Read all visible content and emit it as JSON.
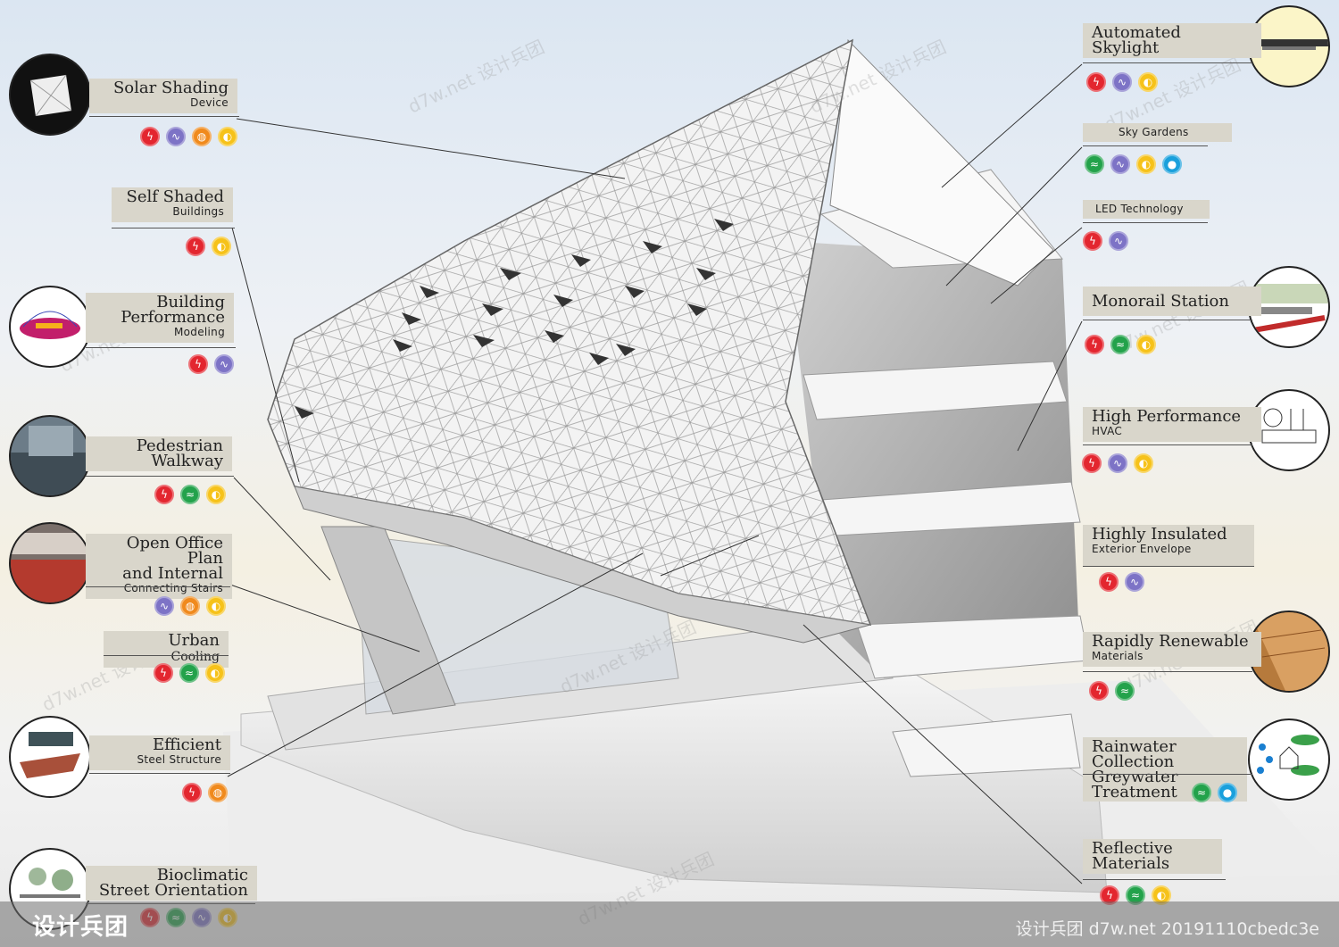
{
  "colors": {
    "energy": "#e3262f",
    "water_green": "#23a24b",
    "air": "#7d73c6",
    "materials": "#f08a1d",
    "light": "#f6c21a",
    "water": "#1aa0dc"
  },
  "icons": {
    "energy": "lightning-icon",
    "water_green": "leaf-icon",
    "air": "wind-icon",
    "materials": "material-icon",
    "light": "lightbulb-icon",
    "water": "waterdrop-icon"
  },
  "left_labels": [
    {
      "id": "solar-shading",
      "line1": "Solar Shading",
      "line2": "Device",
      "dots": [
        "energy",
        "air",
        "materials",
        "light"
      ]
    },
    {
      "id": "self-shaded",
      "line1": "Self Shaded",
      "line2": "Buildings",
      "dots": [
        "energy",
        "light"
      ]
    },
    {
      "id": "building-performance",
      "line1": "Building",
      "line1b": "Performance",
      "line2": "Modeling",
      "dots": [
        "energy",
        "air"
      ]
    },
    {
      "id": "pedestrian-walkway",
      "line1": "Pedestrian",
      "line1b": "Walkway",
      "line2": "",
      "dots": [
        "energy",
        "water_green",
        "light"
      ]
    },
    {
      "id": "open-office",
      "line1": "Open Office Plan",
      "line1b": "and Internal",
      "line2": "Connecting Stairs",
      "dots": [
        "air",
        "materials",
        "light"
      ]
    },
    {
      "id": "urban-cooling",
      "line1": "Urban",
      "line1s": "Cooling",
      "line2": "",
      "dots": [
        "energy",
        "water_green",
        "light"
      ]
    },
    {
      "id": "efficient-steel",
      "line1": "Efficient",
      "line2": "Steel Structure",
      "dots": [
        "energy",
        "materials"
      ]
    },
    {
      "id": "bioclimatic",
      "line1": "Bioclimatic",
      "line1b": "Street Orientation",
      "line2": "",
      "dots": [
        "energy",
        "water_green",
        "air",
        "light"
      ]
    }
  ],
  "right_labels": [
    {
      "id": "automated-skylight",
      "line1": "Automated",
      "line1b": "Skylight",
      "line2": "",
      "dots": [
        "energy",
        "air",
        "light"
      ]
    },
    {
      "id": "sky-gardens",
      "line1": "",
      "line2": "Sky Gardens",
      "dots": [
        "water_green",
        "air",
        "light",
        "water"
      ]
    },
    {
      "id": "led-technology",
      "line1": "",
      "line2": "LED Technology",
      "dots": [
        "energy",
        "air"
      ]
    },
    {
      "id": "monorail-station",
      "line1": "Monorail Station",
      "line2": "",
      "dots": [
        "energy",
        "water_green",
        "light"
      ]
    },
    {
      "id": "high-performance-hvac",
      "line1": "High Performance",
      "line2": "HVAC",
      "dots": [
        "energy",
        "air",
        "light"
      ]
    },
    {
      "id": "highly-insulated",
      "line1": "Highly Insulated",
      "line2": "Exterior Envelope",
      "dots": [
        "energy",
        "air"
      ]
    },
    {
      "id": "rapidly-renewable",
      "line1": "Rapidly Renewable",
      "line2": "Materials",
      "dots": [
        "energy",
        "water_green"
      ]
    },
    {
      "id": "rainwater-collection",
      "line1": "Rainwater Collection",
      "line1b": "Greywater Treatment",
      "line2": "",
      "dots": [
        "water_green",
        "water"
      ]
    },
    {
      "id": "reflective-materials",
      "line1": "Reflective",
      "line1b": "Materials",
      "line2": "",
      "dots": [
        "energy",
        "water_green",
        "light"
      ]
    }
  ],
  "footer": {
    "watermark": "设计兵团 d7w.net 20191110cbedc3e",
    "logo": "设计兵团"
  },
  "watermark_text": {
    "a": "d7w.net 设计兵团",
    "b": "设计兵团"
  }
}
